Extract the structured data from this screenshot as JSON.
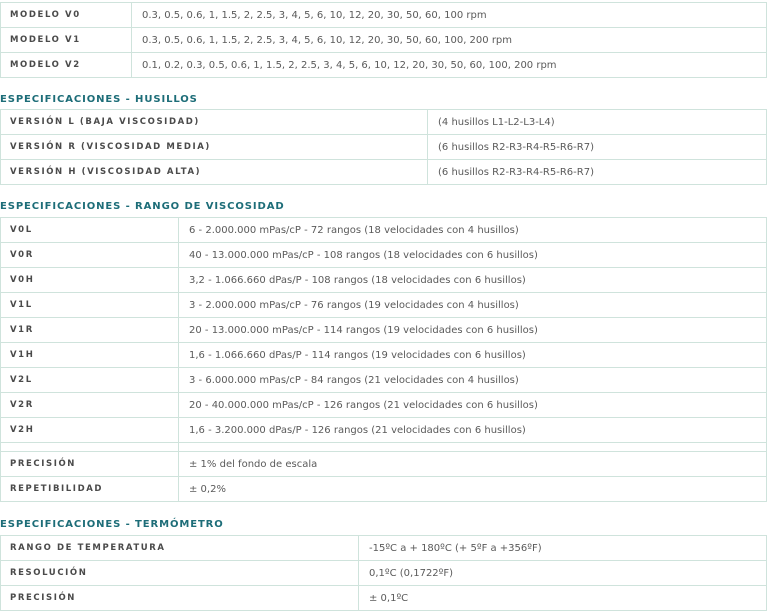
{
  "modelos": [
    {
      "label": "MODELO V0",
      "value": "0.3, 0.5, 0.6, 1, 1.5, 2, 2.5, 3, 4, 5, 6, 10, 12, 20, 30, 50, 60, 100 rpm"
    },
    {
      "label": "MODELO V1",
      "value": "0.3, 0.5, 0.6, 1, 1.5, 2, 2.5, 3, 4, 5, 6, 10, 12, 20, 30, 50, 60, 100, 200 rpm"
    },
    {
      "label": "MODELO V2",
      "value": "0.1, 0.2, 0.3, 0.5, 0.6, 1, 1.5, 2, 2.5, 3, 4, 5, 6, 10, 12, 20, 30, 50, 60, 100, 200 rpm"
    }
  ],
  "husillos": {
    "title": "ESPECIFICACIONES - HUSILLOS",
    "rows": [
      {
        "label": "VERSIÓN L (BAJA VISCOSIDAD)",
        "value": "(4 husillos L1-L2-L3-L4)"
      },
      {
        "label": "VERSIÓN R (VISCOSIDAD MEDIA)",
        "value": "(6 husillos R2-R3-R4-R5-R6-R7)"
      },
      {
        "label": "VERSIÓN H (VISCOSIDAD ALTA)",
        "value": "(6 husillos R2-R3-R4-R5-R6-R7)"
      }
    ]
  },
  "rango": {
    "title": "ESPECIFICACIONES - RANGO DE VISCOSIDAD",
    "rows": [
      {
        "label": "V0L",
        "value": "6 - 2.000.000 mPas/cP - 72 rangos (18 velocidades con 4 husillos)"
      },
      {
        "label": "V0R",
        "value": "40 - 13.000.000 mPas/cP - 108 rangos (18 velocidades con 6 husillos)"
      },
      {
        "label": "V0H",
        "value": "3,2 - 1.066.660 dPas/P - 108 rangos (18 velocidades con 6 husillos)"
      },
      {
        "label": "V1L",
        "value": "3 - 2.000.000 mPas/cP - 76 rangos (19 velocidades con 4 husillos)"
      },
      {
        "label": "V1R",
        "value": "20 - 13.000.000 mPas/cP - 114 rangos (19 velocidades con 6 husillos)"
      },
      {
        "label": "V1H",
        "value": "1,6 - 1.066.660 dPas/P - 114 rangos (19 velocidades con 6 husillos)"
      },
      {
        "label": "V2L",
        "value": "3 - 6.000.000 mPas/cP - 84 rangos (21 velocidades con 4 husillos)"
      },
      {
        "label": "V2R",
        "value": "20 - 40.000.000 mPas/cP - 126 rangos (21 velocidades con 6 husillos)"
      },
      {
        "label": "V2H",
        "value": "1,6 - 3.200.000 dPas/P - 126 rangos (21 velocidades con 6 husillos)"
      }
    ],
    "precision": {
      "label": "PRECISIÓN",
      "value": "± 1% del fondo de escala"
    },
    "repetibilidad": {
      "label": "REPETIBILIDAD",
      "value": "± 0,2%"
    }
  },
  "termometro": {
    "title": "ESPECIFICACIONES - TERMÓMETRO",
    "rows": [
      {
        "label": "RANGO DE TEMPERATURA",
        "value": "-15ºC a + 180ºC (+ 5ºF a +356ºF)"
      },
      {
        "label": "RESOLUCIÓN",
        "value": "0,1ºC (0,1722ºF)"
      },
      {
        "label": "PRECISIÓN",
        "value": "± 0,1ºC"
      }
    ]
  }
}
